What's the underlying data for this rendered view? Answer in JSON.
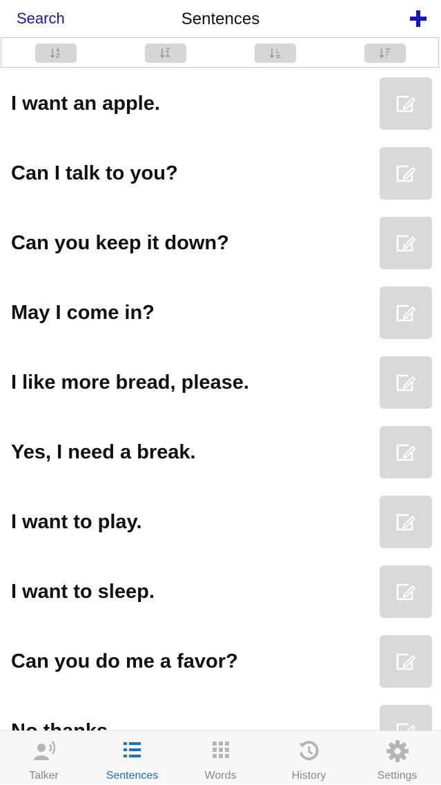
{
  "nav": {
    "back_label": "Search",
    "title": "Sentences",
    "add_icon": "plus-icon"
  },
  "sort_buttons": [
    {
      "icon": "sort-alpha-asc-icon"
    },
    {
      "icon": "sort-alpha-desc-icon"
    },
    {
      "icon": "sort-numeric-asc-icon"
    },
    {
      "icon": "sort-numeric-desc-icon"
    }
  ],
  "sentences": [
    {
      "text": "I want an apple."
    },
    {
      "text": "Can I talk to you?"
    },
    {
      "text": "Can you keep it down?"
    },
    {
      "text": "May I come in?"
    },
    {
      "text": "I like more bread, please."
    },
    {
      "text": "Yes, I need a break."
    },
    {
      "text": "I want to play."
    },
    {
      "text": "I want to sleep."
    },
    {
      "text": "Can you do me a favor?"
    },
    {
      "text": "No thanks."
    }
  ],
  "tabs": [
    {
      "label": "Talker",
      "icon": "talker-icon"
    },
    {
      "label": "Sentences",
      "icon": "list-icon",
      "active": true
    },
    {
      "label": "Words",
      "icon": "grid-icon"
    },
    {
      "label": "History",
      "icon": "history-icon"
    },
    {
      "label": "Settings",
      "icon": "gear-icon"
    }
  ],
  "colors": {
    "accent": "#1a6fd0",
    "nav_link": "#1414c8",
    "button_gray": "#d9d9d9"
  }
}
